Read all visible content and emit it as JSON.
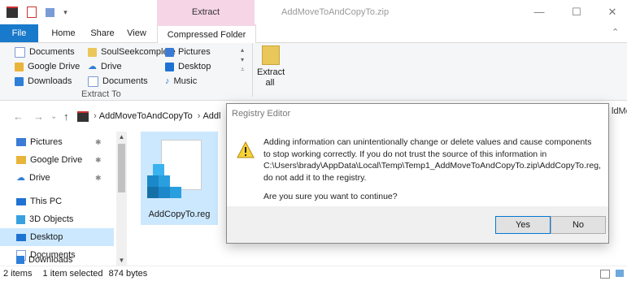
{
  "window": {
    "title": "AddMoveToAndCopyTo.zip",
    "extract_context": "Extract",
    "minimize": "—",
    "maximize": "☐",
    "close": "✕"
  },
  "ribbon": {
    "tabs": [
      "File",
      "Home",
      "Share",
      "View",
      "Compressed Folder Tools"
    ],
    "items": [
      "Documents",
      "Google Drive",
      "Downloads",
      "SoulSeekcomplete",
      "Drive",
      "Documents",
      "Pictures",
      "Desktop",
      "Music"
    ],
    "extract_to": "Extract To",
    "extract_all": "Extract all",
    "colors": {
      "file_tab": "#1979ca",
      "context_tab": "#f6d5e6"
    }
  },
  "address": {
    "back": "←",
    "forward": "→",
    "down": "⌄",
    "up": "↑",
    "crumb1": "AddMoveToAndCopyTo",
    "crumb2": "Addl",
    "right_peek": "ldMo.."
  },
  "nav": {
    "items": [
      {
        "label": "Pictures",
        "pinned": true
      },
      {
        "label": "Google Drive",
        "pinned": true
      },
      {
        "label": "Drive",
        "pinned": true
      },
      {
        "label": "This PC",
        "pinned": false
      },
      {
        "label": "3D Objects",
        "pinned": false
      },
      {
        "label": "Desktop",
        "pinned": false
      },
      {
        "label": "Documents",
        "pinned": false
      },
      {
        "label": "Downloads",
        "pinned": false
      }
    ],
    "pin_glyph": "✱"
  },
  "file": {
    "name": "AddCopyTo.reg"
  },
  "status": {
    "items": "2 items",
    "selected": "1 item selected",
    "size": "874 bytes"
  },
  "dialog": {
    "title": "Registry Editor",
    "message": "Adding information can unintentionally change or delete values and cause components to stop working correctly. If you do not trust the source of this information in C:\\Users\\brady\\AppData\\Local\\Temp\\Temp1_AddMoveToAndCopyTo.zip\\AddCopyTo.reg, do not add it to the registry.",
    "question": "Are you sure you want to continue?",
    "yes": "Yes",
    "no": "No",
    "warning_icon": "warning-icon"
  }
}
